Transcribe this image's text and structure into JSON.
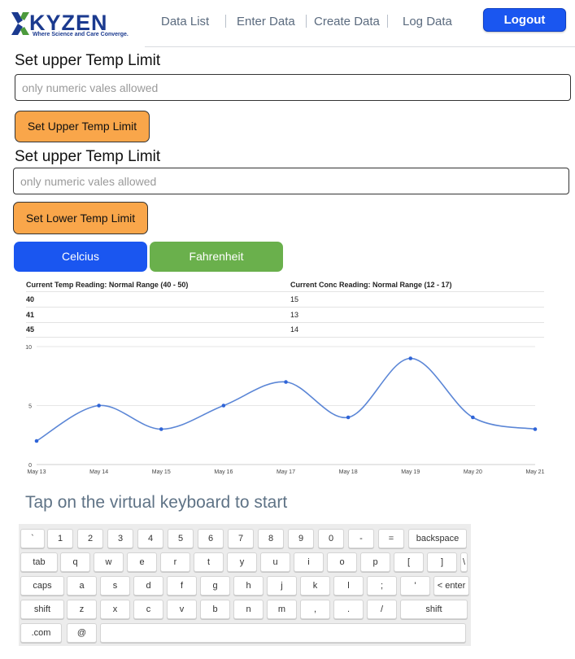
{
  "header": {
    "logo_text": "KYZEN",
    "logo_tagline": "Where Science and Care Converge.",
    "nav": [
      "Data List",
      "Enter Data",
      "Create Data",
      "Log Data"
    ],
    "logout_label": "Logout",
    "colors": {
      "brand": "#1b3a8f",
      "logout": "#1a56f0"
    }
  },
  "upper_limit": {
    "label": "Set upper Temp Limit",
    "placeholder": "only numeric vales allowed",
    "value": "",
    "button_label": "Set Upper Temp Limit"
  },
  "lower_limit": {
    "label": "Set upper Temp Limit",
    "placeholder": "only numeric vales allowed",
    "value": "",
    "button_label": "Set Lower Temp Limit"
  },
  "units": {
    "celsius_label": "Celcius",
    "fahrenheit_label": "Fahrenheit",
    "colors": {
      "celsius": "#1a56f0",
      "fahrenheit": "#6ab04c",
      "action": "#f9a64a"
    }
  },
  "readings": {
    "temp_header": "Current Temp Reading: Normal Range (40 - 50)",
    "conc_header": "Current Conc Reading: Normal Range (12 - 17)",
    "rows": [
      {
        "temp": "40",
        "conc": "15"
      },
      {
        "temp": "41",
        "conc": "13"
      },
      {
        "temp": "45",
        "conc": "14"
      }
    ]
  },
  "chart_data": {
    "type": "line",
    "x": [
      "May 13",
      "May 14",
      "May 15",
      "May 16",
      "May 17",
      "May 18",
      "May 19",
      "May 20",
      "May 21"
    ],
    "series": [
      {
        "values": [
          2,
          5,
          3,
          5,
          7,
          4,
          9,
          4,
          3
        ],
        "color": "#5b86d6"
      }
    ],
    "y_ticks": [
      "0",
      "5",
      "10"
    ],
    "ylim": [
      0,
      10
    ],
    "smooth": true,
    "grid": true
  },
  "keyboard": {
    "title": "Tap on the virtual keyboard to start",
    "rows": [
      [
        "`",
        "1",
        "2",
        "3",
        "4",
        "5",
        "6",
        "7",
        "8",
        "9",
        "0",
        "-",
        "=",
        "backspace"
      ],
      [
        "tab",
        "q",
        "w",
        "e",
        "r",
        "t",
        "y",
        "u",
        "i",
        "o",
        "p",
        "[",
        "]",
        "\\"
      ],
      [
        "caps",
        "a",
        "s",
        "d",
        "f",
        "g",
        "h",
        "j",
        "k",
        "l",
        ";",
        "'",
        "< enter"
      ],
      [
        "shift",
        "z",
        "x",
        "c",
        "v",
        "b",
        "n",
        "m",
        ",",
        ".",
        "/",
        "shift"
      ],
      [
        ".com",
        "@",
        ""
      ]
    ]
  }
}
